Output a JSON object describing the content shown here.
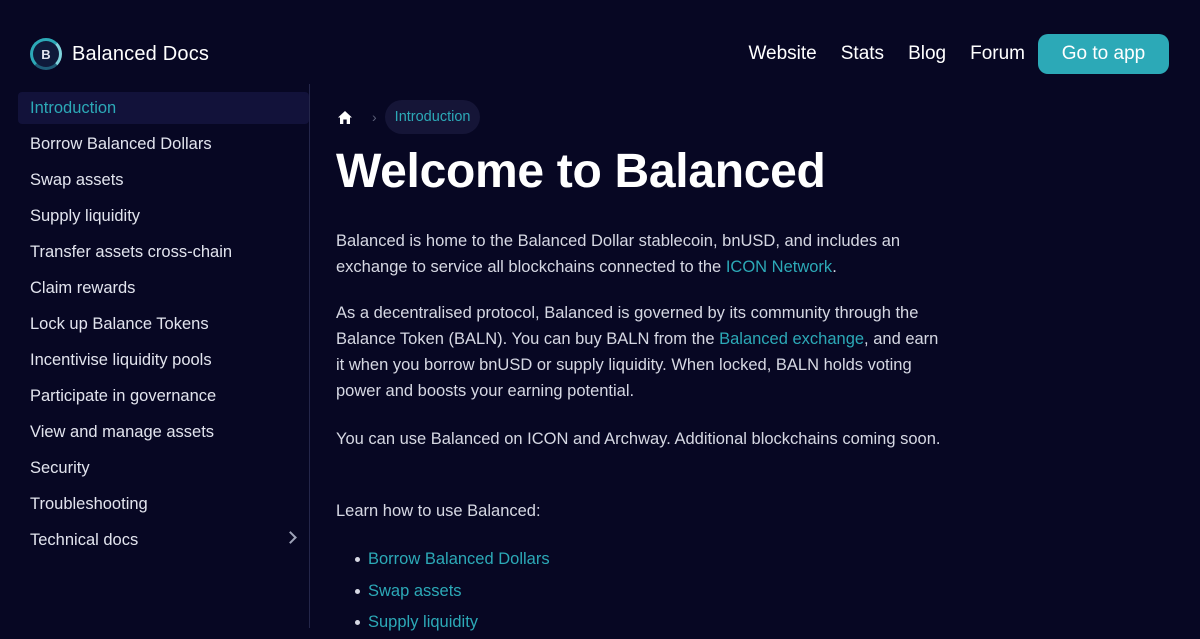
{
  "site": {
    "logo_letter": "B",
    "title": "Balanced Docs"
  },
  "nav": {
    "items": [
      "Website",
      "Stats",
      "Blog",
      "Forum"
    ],
    "cta": "Go to app"
  },
  "sidebar": {
    "items": [
      {
        "label": "Introduction",
        "active": true
      },
      {
        "label": "Borrow Balanced Dollars"
      },
      {
        "label": "Swap assets"
      },
      {
        "label": "Supply liquidity"
      },
      {
        "label": "Transfer assets cross-chain"
      },
      {
        "label": "Claim rewards"
      },
      {
        "label": "Lock up Balance Tokens"
      },
      {
        "label": "Incentivise liquidity pools"
      },
      {
        "label": "Participate in governance"
      },
      {
        "label": "View and manage assets"
      },
      {
        "label": "Security"
      },
      {
        "label": "Troubleshooting"
      },
      {
        "label": "Technical docs",
        "expandable": true
      }
    ]
  },
  "breadcrumb": {
    "home_icon": "home-icon",
    "separator": "›",
    "current": "Introduction"
  },
  "main": {
    "title": "Welcome to Balanced",
    "p1": {
      "text_before": "Balanced is home to the Balanced Dollar stablecoin, bnUSD, and includes an exchange to service all blockchains connected to the ",
      "link": "ICON Network",
      "text_after": "."
    },
    "p2": {
      "text_before": "As a decentralised protocol, Balanced is governed by its community through the Balance Token (BALN). You can buy BALN from the ",
      "link": "Balanced exchange",
      "text_after": ", and earn it when you borrow bnUSD or supply liquidity. When locked, BALN holds voting power and boosts your earning potential."
    },
    "p3": "You can use Balanced on ICON and Archway. Additional blockchains coming soon.",
    "p4": "Learn how to use Balanced:",
    "learn_links": [
      "Borrow Balanced Dollars",
      "Swap assets",
      "Supply liquidity"
    ]
  },
  "colors": {
    "background": "#070723",
    "accent": "#2ca9b7",
    "active_bg": "#12123a"
  }
}
